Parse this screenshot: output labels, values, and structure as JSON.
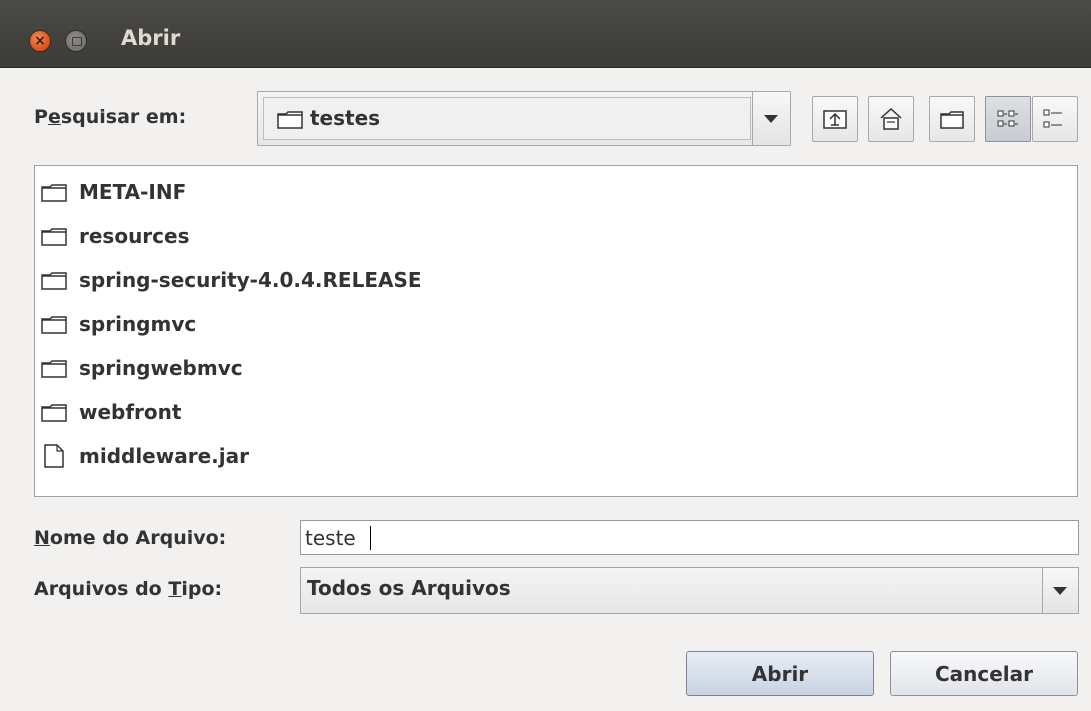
{
  "window": {
    "title": "Abrir"
  },
  "look_in": {
    "label_before": "P",
    "label_mnemonic": "e",
    "label_after": "squisar em:",
    "value": "testes"
  },
  "toolbar": {
    "icons": [
      "up-folder-icon",
      "home-icon",
      "new-folder-icon",
      "list-view-icon",
      "details-view-icon"
    ],
    "selected": "list-view-icon"
  },
  "files": [
    {
      "name": "META-INF",
      "type": "folder"
    },
    {
      "name": "resources",
      "type": "folder"
    },
    {
      "name": "spring-security-4.0.4.RELEASE",
      "type": "folder"
    },
    {
      "name": "springmvc",
      "type": "folder"
    },
    {
      "name": "springwebmvc",
      "type": "folder"
    },
    {
      "name": "webfront",
      "type": "folder"
    },
    {
      "name": "middleware.jar",
      "type": "file"
    }
  ],
  "filename": {
    "label_mnemonic": "N",
    "label_after": "ome do Arquivo:",
    "value": "teste"
  },
  "filetype": {
    "label_before": "Arquivos do ",
    "label_mnemonic": "T",
    "label_after": "ipo:",
    "value": "Todos os Arquivos"
  },
  "buttons": {
    "open": "Abrir",
    "cancel": "Cancelar"
  },
  "colors": {
    "titlebar": "#3c3b37",
    "close": "#e0561e",
    "dialog_bg": "#f2f1f0",
    "list_bg": "#ffffff"
  }
}
